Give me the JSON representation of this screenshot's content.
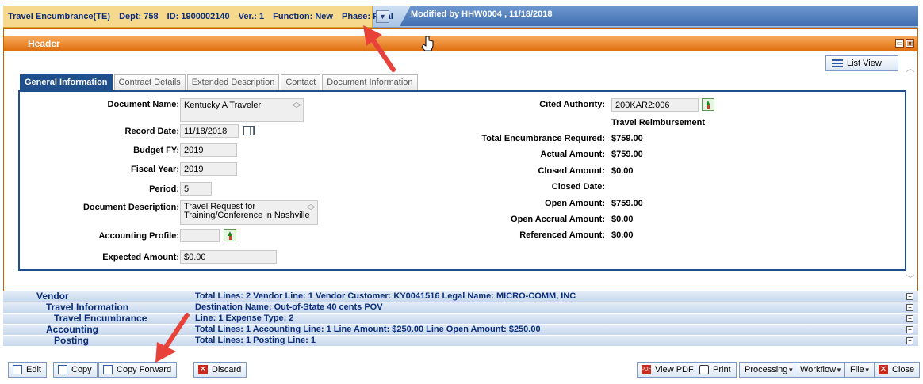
{
  "top_strip": {
    "text": ""
  },
  "doc_header": {
    "title": "Travel Encumbrance(TE)",
    "dept_label": "Dept:",
    "dept": "758",
    "id_label": "ID:",
    "id": "1900002140",
    "ver_label": "Ver.:",
    "ver": "1",
    "function_label": "Function:",
    "function": "New",
    "phase_label": "Phase:",
    "phase": "Final",
    "modified": "Modified by HHW0004 , 11/18/2018"
  },
  "header_section": {
    "title": "Header",
    "list_view": "List View"
  },
  "tabs": [
    {
      "label": "General Information",
      "active": true
    },
    {
      "label": "Contract Details",
      "active": false
    },
    {
      "label": "Extended Description",
      "active": false
    },
    {
      "label": "Contact",
      "active": false
    },
    {
      "label": "Document Information",
      "active": false
    }
  ],
  "left_fields": {
    "document_name": {
      "label": "Document Name:",
      "value": "Kentucky A Traveler"
    },
    "record_date": {
      "label": "Record Date:",
      "value": "11/18/2018"
    },
    "budget_fy": {
      "label": "Budget FY:",
      "value": "2019"
    },
    "fiscal_year": {
      "label": "Fiscal Year:",
      "value": "2019"
    },
    "period": {
      "label": "Period:",
      "value": "5"
    },
    "document_description": {
      "label": "Document Description:",
      "line1": "Travel Request for",
      "line2": "Training/Conference in Nashville"
    },
    "accounting_profile": {
      "label": "Accounting Profile:",
      "value": ""
    },
    "expected_amount": {
      "label": "Expected Amount:",
      "value": "$0.00"
    }
  },
  "right_fields": {
    "cited_authority": {
      "label": "Cited Authority:",
      "value": "200KAR2:006"
    },
    "cited_authority_desc": "Travel Reimbursement",
    "total_encumbrance": {
      "label": "Total Encumbrance Required:",
      "value": "$759.00"
    },
    "actual_amount": {
      "label": "Actual Amount:",
      "value": "$759.00"
    },
    "closed_amount": {
      "label": "Closed Amount:",
      "value": "$0.00"
    },
    "closed_date": {
      "label": "Closed Date:",
      "value": ""
    },
    "open_amount": {
      "label": "Open Amount:",
      "value": "$759.00"
    },
    "open_accrual_amount": {
      "label": "Open Accrual Amount:",
      "value": "$0.00"
    },
    "referenced_amount": {
      "label": "Referenced Amount:",
      "value": "$0.00"
    }
  },
  "sections": [
    {
      "name": "Vendor",
      "info": "Total Lines: 2   Vendor Line: 1   Vendor Customer: KY0041516   Legal Name: MICRO-COMM, INC"
    },
    {
      "name": "Travel Information",
      "info": "Destination Name: Out-of-State 40 cents POV"
    },
    {
      "name": "Travel Encumbrance",
      "info": "Line: 1   Expense Type: 2"
    },
    {
      "name": "Accounting",
      "info": "Total Lines: 1   Accounting Line: 1   Line Amount: $250.00   Line Open Amount: $250.00"
    },
    {
      "name": "Posting",
      "info": "Total Lines: 1   Posting Line: 1"
    }
  ],
  "toolbar": {
    "edit": "Edit",
    "copy": "Copy",
    "copy_forward": "Copy Forward",
    "discard": "Discard",
    "view_pdf": "View PDF",
    "print": "Print",
    "processing": "Processing",
    "workflow": "Workflow",
    "file": "File",
    "close": "Close"
  },
  "colors": {
    "header_orange": "#e06f10",
    "tab_active": "#1f4f8c",
    "annotation_arrow": "#e8413a",
    "doc_info_bg": "#f6d98c"
  }
}
